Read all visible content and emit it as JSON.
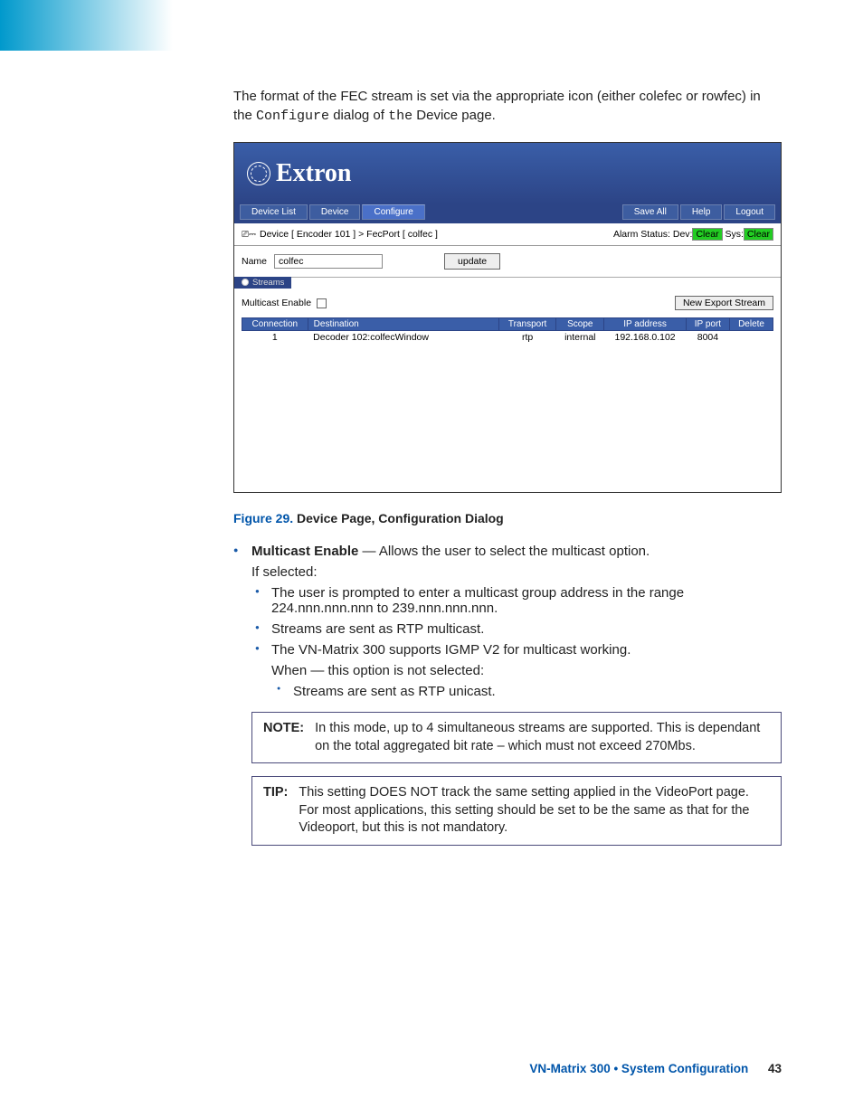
{
  "intro_part1": "The format of the FEC stream is set via the appropriate icon (either colefec or rowfec) in the ",
  "intro_configure": "Configure",
  "intro_part2": " dialog of ",
  "intro_the": "the",
  "intro_part3": " Device page.",
  "app": {
    "brand": "Extron",
    "tabs_left": {
      "t0": "Device List",
      "t1": "Device",
      "t2": "Configure"
    },
    "tabs_right": {
      "t0": "Save All",
      "t1": "Help",
      "t2": "Logout"
    },
    "breadcrumb_lead": "Device [ Encoder 101 ]  >  FecPort [ colfec ]",
    "alarm_label": "Alarm Status: Dev:",
    "alarm_dev": "Clear",
    "alarm_sys_label": "Sys:",
    "alarm_sys": "Clear",
    "name_label": "Name",
    "name_value": "colfec",
    "update_btn": "update",
    "streams_tab": "Streams",
    "multicast_label": "Multicast Enable",
    "new_stream": "New Export Stream",
    "headers": {
      "h0": "Connection",
      "h1": "Destination",
      "h2": "Transport",
      "h3": "Scope",
      "h4": "IP address",
      "h5": "IP port",
      "h6": "Delete"
    },
    "row": {
      "c0": "1",
      "c1": "Decoder 102:colfecWindow",
      "c2": "rtp",
      "c3": "internal",
      "c4": "192.168.0.102",
      "c5": "8004",
      "c6": ""
    }
  },
  "caption_label": "Figure 29.",
  "caption_text": " Device Page, Configuration Dialog",
  "b1_strong": "Multicast Enable",
  "b1_rest": " — Allows the user to select the multicast option.",
  "b1_sel": "If selected:",
  "s1": "The user is prompted to enter a multicast group address in the range 224.nnn.nnn.nnn to 239.nnn.nnn.nnn.",
  "s2": "Streams are sent as RTP multicast.",
  "s3": "The VN-Matrix 300 supports IGMP V2 for multicast working.",
  "s3_when": "When — this option is not selected:",
  "ss1": "Streams are sent as RTP unicast.",
  "note_tag": "NOTE:",
  "note_body": "In this mode, up to 4 simultaneous streams are supported. This is dependant on the total aggregated bit rate – which must not exceed 270Mbs.",
  "tip_tag": "TIP:",
  "tip_body": "This setting DOES NOT track the same setting applied in the VideoPort page. For most applications, this setting should be set to be the same as that for the Videoport, but this is not mandatory.",
  "footer_title": "VN-Matrix 300 • System Configuration",
  "footer_page": "43"
}
